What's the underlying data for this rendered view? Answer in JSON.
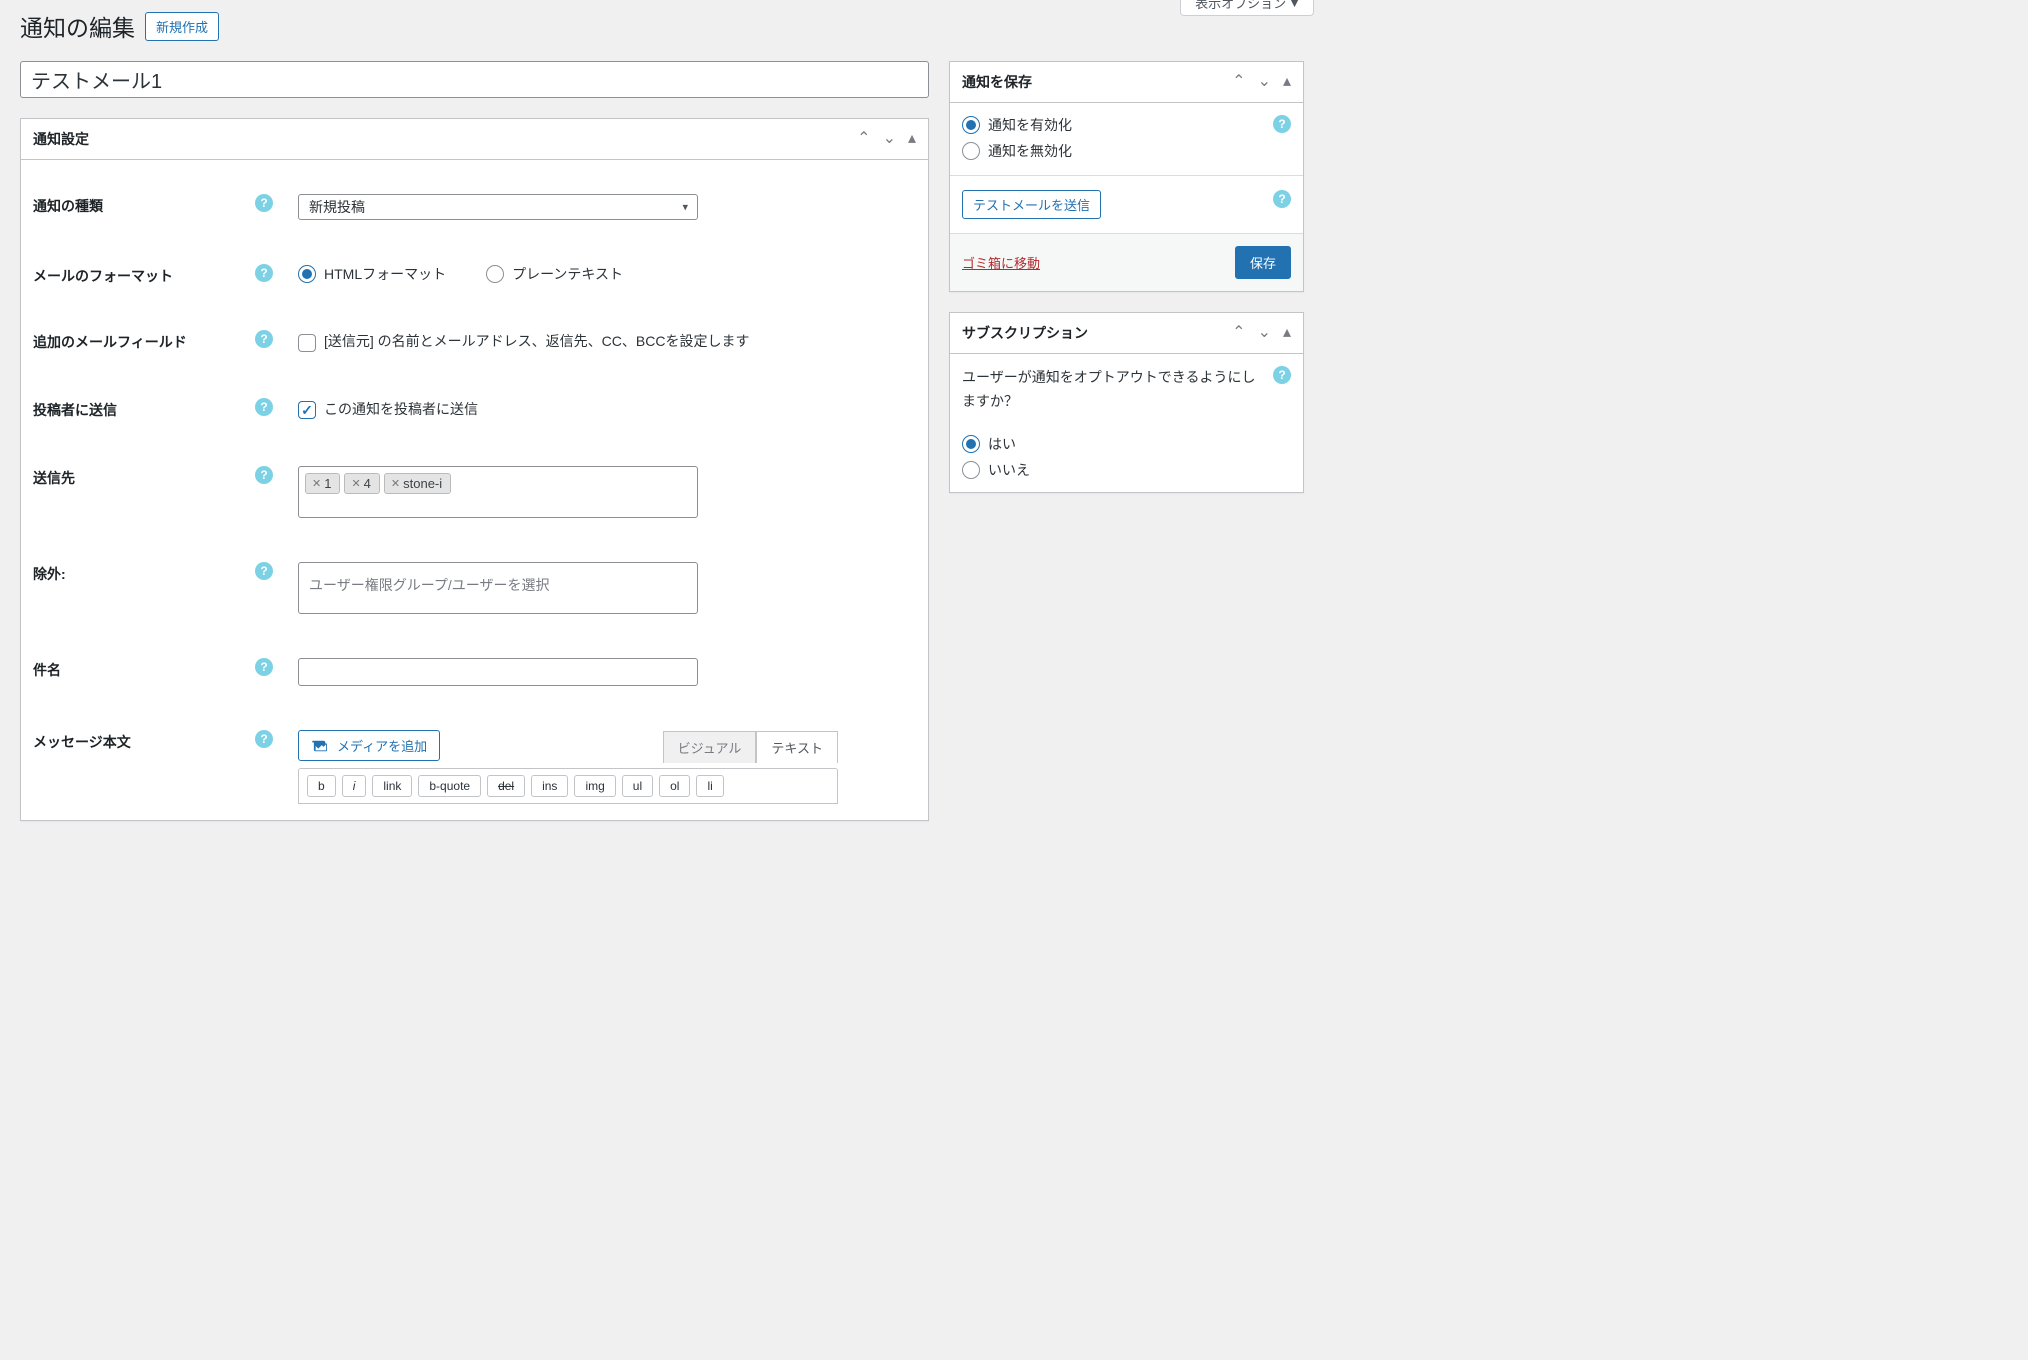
{
  "header": {
    "page_title": "通知の編集",
    "new_button": "新規作成",
    "display_options": "表示オプション"
  },
  "title_field": {
    "value": "テストメール1"
  },
  "notification_settings": {
    "box_title": "通知設定",
    "fields": {
      "type": {
        "label": "通知の種類",
        "selected": "新規投稿"
      },
      "mail_format": {
        "label": "メールのフォーマット",
        "options": {
          "html": "HTMLフォーマット",
          "plain": "プレーンテキスト"
        },
        "value": "html"
      },
      "extra_fields": {
        "label": "追加のメールフィールド",
        "checkbox_text": "[送信元] の名前とメールアドレス、返信先、CC、BCCを設定します",
        "checked": false
      },
      "send_to_author": {
        "label": "投稿者に送信",
        "checkbox_text": "この通知を投稿者に送信",
        "checked": true
      },
      "send_to": {
        "label": "送信先",
        "tags": [
          "1",
          "4",
          "stone-i"
        ]
      },
      "exclude": {
        "label": "除外:",
        "placeholder": "ユーザー権限グループ/ユーザーを選択"
      },
      "subject": {
        "label": "件名",
        "value": ""
      },
      "message": {
        "label": "メッセージ本文",
        "media_button": "メディアを追加",
        "tabs": {
          "visual": "ビジュアル",
          "text": "テキスト"
        },
        "quicktags": [
          "b",
          "i",
          "link",
          "b-quote",
          "del",
          "ins",
          "img",
          "ul",
          "ol",
          "li"
        ]
      }
    }
  },
  "save_box": {
    "title": "通知を保存",
    "enable_label": "通知を有効化",
    "disable_label": "通知を無効化",
    "status_value": "enable",
    "test_mail_button": "テストメールを送信",
    "trash_link": "ゴミ箱に移動",
    "save_button": "保存"
  },
  "subscription_box": {
    "title": "サブスクリプション",
    "question": "ユーザーが通知をオプトアウトできるようにしますか？",
    "yes_label": "はい",
    "no_label": "いいえ",
    "value": "yes"
  }
}
